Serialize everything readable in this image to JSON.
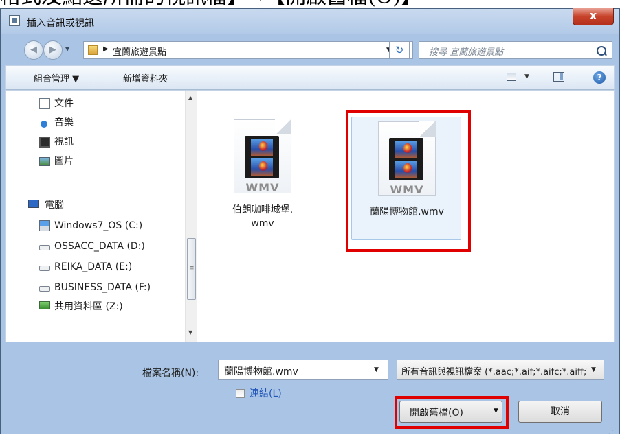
{
  "page": {
    "heading": "格式及點選所需的視訊檔】→【開啟舊檔(O)】"
  },
  "window": {
    "title": "插入音訊或視訊",
    "close_glyph": "x"
  },
  "navbar": {
    "back_glyph": "◀",
    "forward_glyph": "▶",
    "breadcrumb_folder": "宜蘭旅遊景點",
    "refresh_glyph": "↻",
    "search_placeholder": "搜尋 宜蘭旅遊景點"
  },
  "commandbar": {
    "organize": "組合管理 ▼",
    "new_folder": "新增資料夾",
    "help_glyph": "?"
  },
  "nav_pane": {
    "items": [
      {
        "label": "文件",
        "icon": "document-icon"
      },
      {
        "label": "音樂",
        "icon": "music-icon"
      },
      {
        "label": "視訊",
        "icon": "video-icon"
      },
      {
        "label": "圖片",
        "icon": "pictures-icon"
      },
      {
        "label": "電腦",
        "icon": "computer-icon"
      },
      {
        "label": "Windows7_OS (C:)",
        "icon": "system-drive-icon"
      },
      {
        "label": "OSSACC_DATA (D:)",
        "icon": "drive-icon"
      },
      {
        "label": "REIKA_DATA (E:)",
        "icon": "drive-icon"
      },
      {
        "label": "BUSINESS_DATA (F:)",
        "icon": "drive-icon"
      },
      {
        "label": "共用資料區 (Z:)",
        "icon": "network-drive-icon"
      }
    ]
  },
  "files": [
    {
      "name_line1": "伯朗咖啡城堡.",
      "name_line2": "wmv",
      "type_label": "WMV",
      "selected": false
    },
    {
      "name_line1": "蘭陽博物館.wmv",
      "name_line2": "",
      "type_label": "WMV",
      "selected": true
    }
  ],
  "bottom": {
    "filename_label": "檔案名稱(N):",
    "filename_value": "蘭陽博物館.wmv",
    "filetype_value": "所有音訊與視訊檔案 (*.aac;*.aif;*.aifc;*.aiff;*.asf;*.au;*.avi)",
    "link_label": "連結(L)",
    "link_checked": false,
    "open_label": "開啟舊檔(O)",
    "cancel_label": "取消"
  },
  "colors": {
    "highlight": "#e00000",
    "link": "#2156b8",
    "frame": "#a9c4e4"
  }
}
